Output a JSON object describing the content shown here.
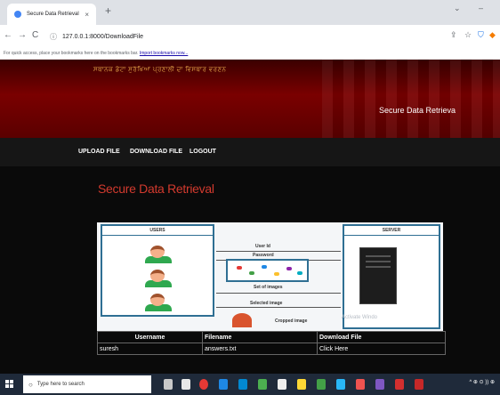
{
  "browser": {
    "tab_title": "Secure Data Retrieval",
    "tab_close": "×",
    "new_tab": "+",
    "url": "127.0.0.1:8000/DownloadFile",
    "bookmarks_hint": "For quick access, place your bookmarks here on the bookmarks bar.",
    "bookmarks_link": "Import bookmarks now..."
  },
  "header": {
    "brand": "Secure Data Retrieva",
    "junk_text": "ਸਥਾਨਕ ਡੇਟਾ ਸੁਰੱਖਿਆ ਪ੍ਰਣਾਲੀ ਦਾ ਵਿਸਥਾਰ ਵਰਣਨ"
  },
  "nav": {
    "items": [
      {
        "label": "UPLOAD FILE"
      },
      {
        "label": "DOWNLOAD FILE"
      },
      {
        "label": "LOGOUT"
      }
    ]
  },
  "main": {
    "title": "Secure Data Retrieval",
    "diagram": {
      "users_label": "USERS",
      "server_label": "SERVER",
      "steps": [
        "User Id",
        "Password",
        "Set of images",
        "Selected image",
        "Cropped image"
      ],
      "watermark": "Activate Windo"
    },
    "table": {
      "headers": [
        "Username",
        "Filename",
        "Download File"
      ],
      "rows": [
        [
          "suresh",
          "answers.txt",
          "Click Here"
        ]
      ]
    }
  },
  "taskbar": {
    "search_placeholder": "Type here to search",
    "tray_text": "^ ⊕ ⊙ )) ⊕"
  },
  "colors": {
    "title": "#d23a2e",
    "header_red": "#7a0000",
    "taskbar": "#1f2a3a"
  }
}
